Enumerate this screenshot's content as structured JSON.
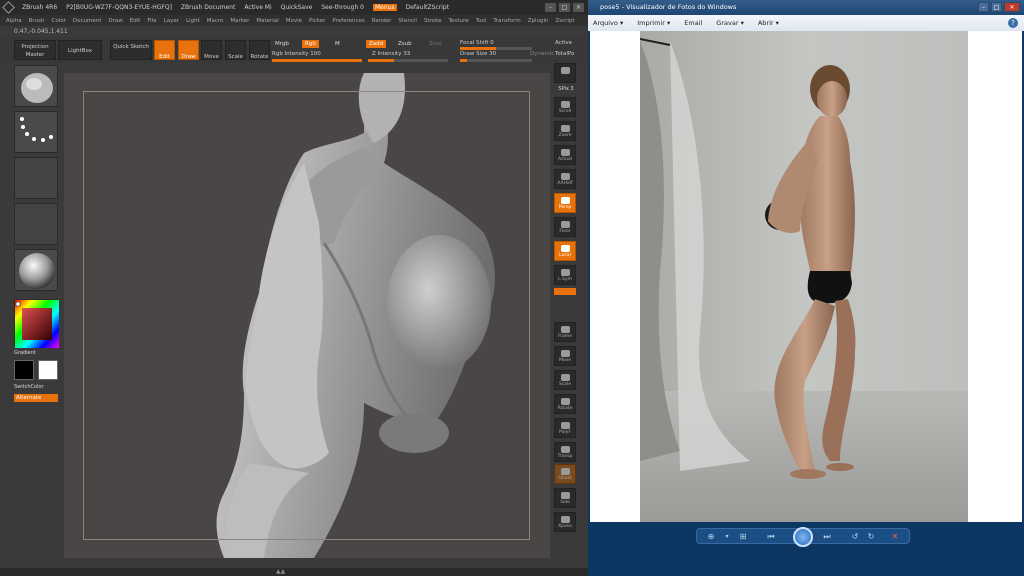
{
  "zbrush": {
    "title_items": [
      "ZBrush 4R6",
      "P2[B0UG-WZ7F-QQN3-EYUE-HGFQ]",
      "ZBrush Document",
      "Active Mi",
      "QuickSave",
      "See-through 0",
      "Menus",
      "DefaultZScript"
    ],
    "menu": [
      "Alpha",
      "Brush",
      "Color",
      "Document",
      "Draw",
      "Edit",
      "File",
      "Layer",
      "Light",
      "Macro",
      "Marker",
      "Material",
      "Movie",
      "Picker",
      "Preferences",
      "Render",
      "Stencil",
      "Stroke",
      "Texture",
      "Tool",
      "Transform",
      "Zplugin",
      "Zscript"
    ],
    "coords": "0.47,-0.045,1.411",
    "toolbar": {
      "projection_master": "Projection Master",
      "lightbox": "LightBox",
      "quick_sketch": "Quick Sketch",
      "edit": "Edit",
      "draw": "Draw",
      "move": "Move",
      "scale": "Scale",
      "rotate": "Rotate",
      "mrgb": "Mrgb",
      "rgb": "Rgb",
      "m": "M",
      "zadd": "Zadd",
      "zsub": "Zsub",
      "zcut": "Zcut",
      "rgb_intensity": "Rgb Intensity 100",
      "rgb_intensity_value": 1.0,
      "z_intensity": "Z Intensity 33",
      "z_intensity_value": 0.33,
      "focal_shift": "Focal Shift 0",
      "focal_shift_value": 0.5,
      "draw_size": "Draw Size 30",
      "draw_size_value": 0.1,
      "dynamic": "Dynamic",
      "active_points": "Active",
      "total_points": "TotalPo"
    },
    "left": {
      "gradient": "Gradient",
      "switch_color": "SwitchColor",
      "alternate": "Alternate"
    },
    "right": {
      "spix": "SPix 3",
      "buttons": [
        "Scroll",
        "Zoom",
        "Actual",
        "AAHalf",
        "Persp",
        "Floor",
        "Local",
        "L.Sym",
        "Frame",
        "Move",
        "Scale",
        "Rotate",
        "PolyF",
        "Transp",
        "Ghost",
        "Solo",
        "Xpose"
      ]
    }
  },
  "photo_viewer": {
    "title": "pose5 - Visualizador de Fotos do Windows",
    "menu": {
      "arquivo": "Arquivo",
      "imprimir": "Imprimir",
      "email": "Email",
      "gravar": "Gravar",
      "abrir": "Abrir"
    }
  },
  "colors": {
    "accent": "#e8720c",
    "zbrush_bg": "#3a3a3a",
    "canvas": "#4a4645",
    "viewer_frame": "#0c3763"
  }
}
